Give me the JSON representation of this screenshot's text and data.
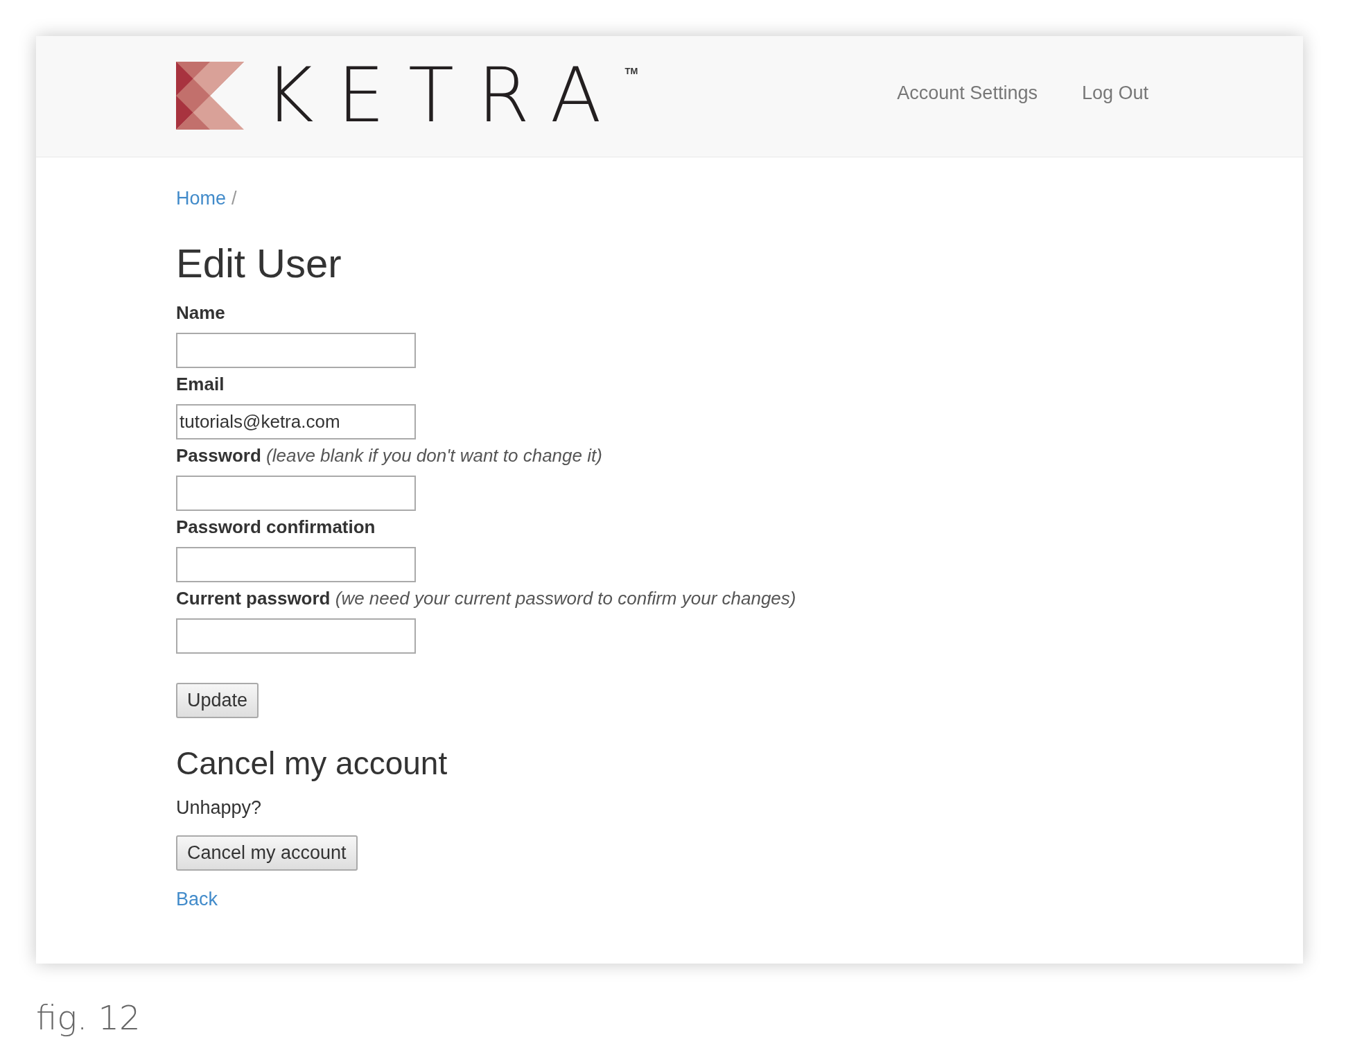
{
  "header": {
    "logo": {
      "wordmark": "KETRA",
      "trademark": "TM"
    },
    "nav": [
      {
        "label": "Account Settings"
      },
      {
        "label": "Log Out"
      }
    ]
  },
  "breadcrumb": {
    "link": "Home",
    "separator": "/"
  },
  "title": "Edit User",
  "fields": [
    {
      "label": "**Name**"
    },
    {
      "label": "**Email**",
      "value": "tutorials@ketra.com"
    },
    {
      "label": "**Password** *(leave blank if you don't want to change it)*"
    },
    {
      "label": "**Password confirmation**"
    },
    {
      "label": "**Current password** *(we need your current password to confirm your changes)*"
    }
  ],
  "submit": "Update",
  "cancel_section": {
    "heading": "Cancel my account",
    "text": "Unhappy?",
    "button": "Cancel my account"
  },
  "back_link": "Back",
  "caption": "fig. 12"
}
